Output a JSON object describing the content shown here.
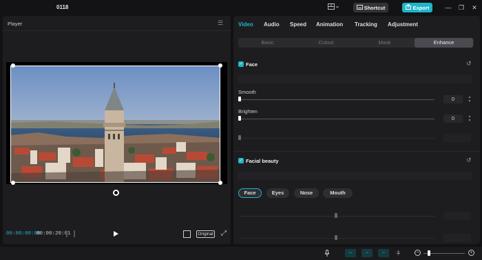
{
  "app": {
    "project_name": "0118"
  },
  "header": {
    "shortcut_label": "Shortcut",
    "export_label": "Export"
  },
  "player": {
    "title": "Player",
    "timecode_current": "00:00:00:00",
    "timecode_total": "00:00:20:01",
    "original_label": "Original"
  },
  "inspector": {
    "tabs": [
      "Video",
      "Audio",
      "Speed",
      "Animation",
      "Tracking",
      "Adjustment"
    ],
    "subtabs": [
      "Basic",
      "Cutout",
      "Mask",
      "Enhance"
    ],
    "face_section": {
      "title": "Face",
      "smooth_label": "Smooth",
      "smooth_value": "0",
      "smooth_level": 0,
      "brighten_label": "Brighten",
      "brighten_value": "0",
      "brighten_level": 0
    },
    "beauty_section": {
      "title": "Facial beauty",
      "pills": [
        "Face",
        "Eyes",
        "Nose",
        "Mouth"
      ]
    }
  },
  "colors": {
    "accent": "#1fb5c9",
    "panel": "#1d1d20",
    "background": "#121214"
  },
  "icons": [
    "layout-icon",
    "keyboard-icon",
    "upload-icon",
    "minimize-icon",
    "restore-icon",
    "close-icon",
    "menu-icon",
    "rotate-icon",
    "play-icon",
    "fit-icon",
    "fullscreen-icon",
    "reset-icon",
    "microphone-icon",
    "link-icon",
    "split-icon",
    "zoom-out-icon",
    "zoom-in-icon"
  ]
}
